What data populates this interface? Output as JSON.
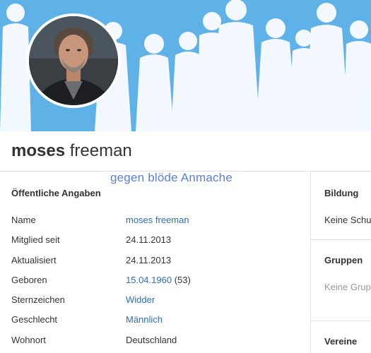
{
  "profile": {
    "first_name": "moses",
    "last_name": "freeman",
    "watermark": "gegen blöde Anmache"
  },
  "public_info": {
    "title": "Öffentliche Angaben",
    "rows": [
      {
        "label": "Name",
        "value": "moses freeman",
        "link": true
      },
      {
        "label": "Mitglied seit",
        "value": "24.11.2013",
        "link": false
      },
      {
        "label": "Aktualisiert",
        "value": "24.11.2013",
        "link": false
      },
      {
        "label": "Geboren",
        "value": "15.04.1960",
        "extra": "(53)",
        "link": true
      },
      {
        "label": "Sternzeichen",
        "value": "Widder",
        "link": true
      },
      {
        "label": "Geschlecht",
        "value": "Männlich",
        "link": true
      },
      {
        "label": "Wohnort",
        "value": "Deutschland",
        "link": false
      }
    ]
  },
  "sidebar": {
    "education_title": "Bildung",
    "education_text": "Keine Schu",
    "groups_title": "Gruppen",
    "groups_text": "Keine Grup",
    "clubs_title": "Vereine"
  },
  "colors": {
    "banner": "#5eb2e8",
    "link": "#2d6fb8",
    "watermark": "#5a7fe0",
    "muted": "#999999"
  }
}
